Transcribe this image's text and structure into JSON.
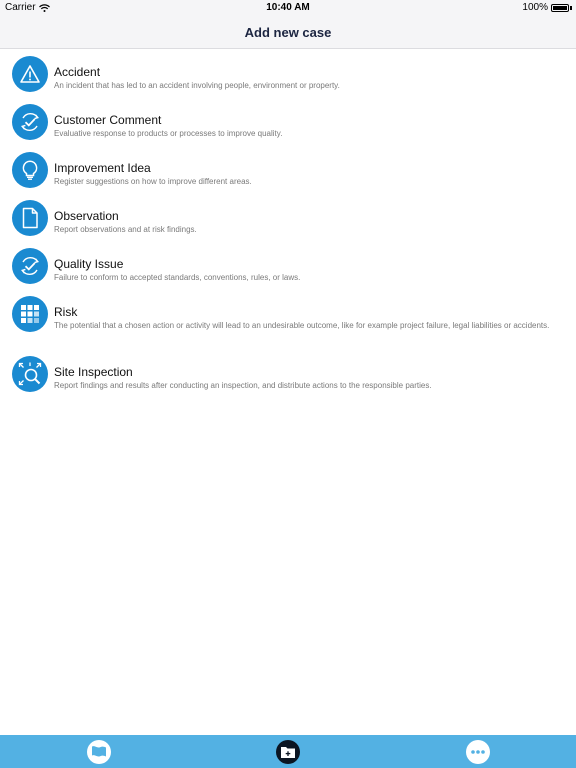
{
  "status": {
    "carrier": "Carrier",
    "time": "10:40 AM",
    "battery": "100%"
  },
  "header": {
    "title": "Add new case"
  },
  "items": [
    {
      "name": "Accident",
      "desc": "An incident that has led to an accident involving people, environment or property.",
      "icon": "warning-icon"
    },
    {
      "name": "Customer Comment",
      "desc": "Evaluative response to products or processes to improve quality.",
      "icon": "check-cycle-icon"
    },
    {
      "name": "Improvement Idea",
      "desc": "Register suggestions on how to improve different areas.",
      "icon": "lightbulb-icon"
    },
    {
      "name": "Observation",
      "desc": "Report observations and at risk findings.",
      "icon": "document-icon"
    },
    {
      "name": "Quality Issue",
      "desc": "Failure to conform to accepted standards, conventions, rules, or laws.",
      "icon": "check-cycle-icon"
    },
    {
      "name": "Risk",
      "desc": "The potential that a chosen action or activity will lead to an undesirable outcome, like for example project failure, legal liabilities or accidents.",
      "icon": "grid-icon"
    },
    {
      "name": "Site Inspection",
      "desc": "Report findings and results after conducting an inspection, and distribute actions to the responsible parties.",
      "icon": "magnifier-icon"
    }
  ],
  "tabs": [
    {
      "icon": "flag-icon"
    },
    {
      "icon": "new-case-folder-icon"
    },
    {
      "icon": "more-icon"
    }
  ],
  "colors": {
    "accent": "#1a8ad1",
    "tabbar": "#53b1e3",
    "title": "#1c2541",
    "description": "#7a7a7a"
  }
}
